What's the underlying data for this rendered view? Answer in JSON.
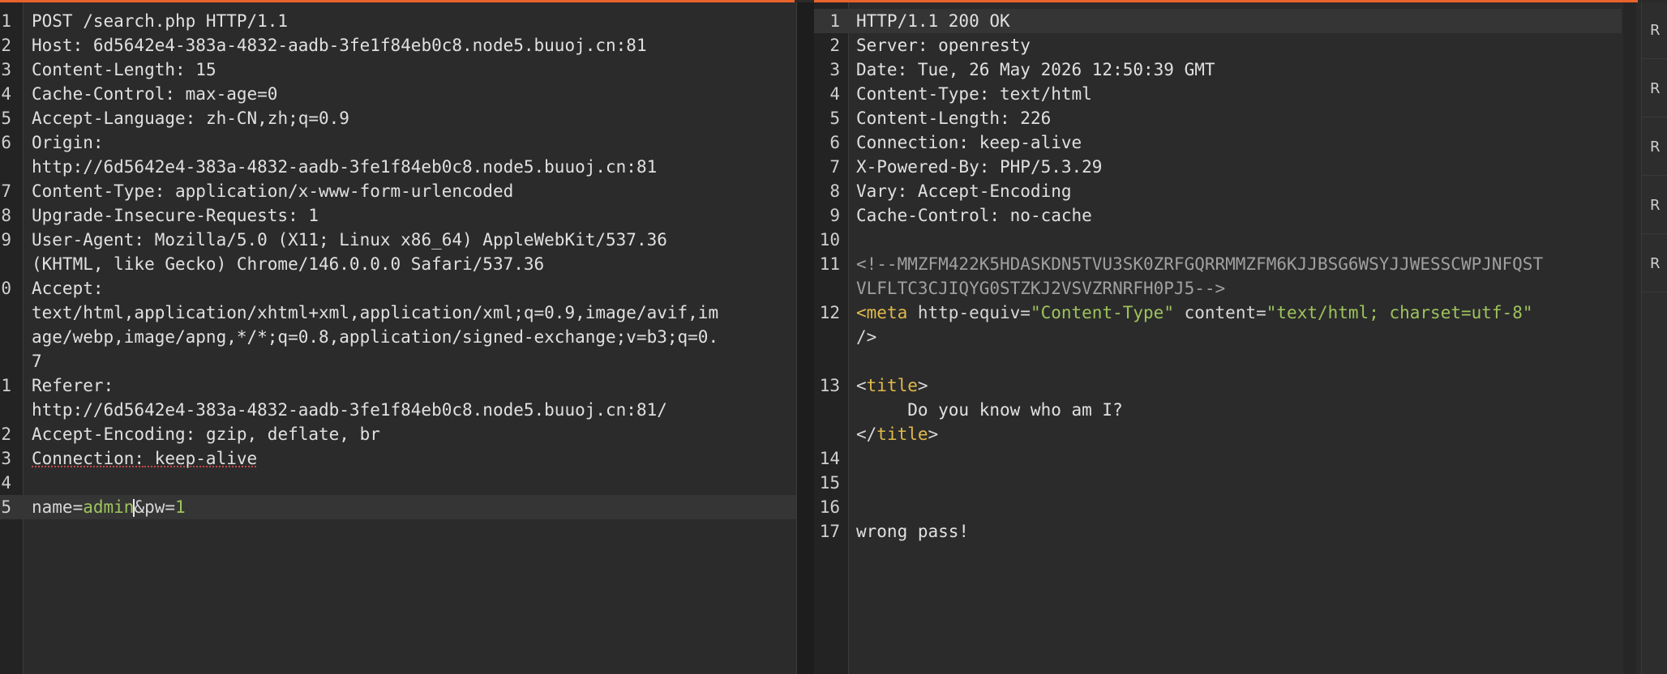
{
  "request": {
    "lines": [
      {
        "n": "1",
        "key": "",
        "val": "POST /search.php HTTP/1.1"
      },
      {
        "n": "2",
        "key": "Host:",
        "val": " 6d5642e4-383a-4832-aadb-3fe1f84eb0c8.node5.buuoj.cn:81"
      },
      {
        "n": "3",
        "key": "Content-Length:",
        "val": " 15"
      },
      {
        "n": "4",
        "key": "Cache-Control:",
        "val": " max-age=0"
      },
      {
        "n": "5",
        "key": "Accept-Language:",
        "val": " zh-CN,zh;q=0.9"
      },
      {
        "n": "6",
        "key": "Origin:",
        "val": ""
      },
      {
        "n": "",
        "key": "",
        "val": "http://6d5642e4-383a-4832-aadb-3fe1f84eb0c8.node5.buuoj.cn:81"
      },
      {
        "n": "7",
        "key": "Content-Type:",
        "val": " application/x-www-form-urlencoded"
      },
      {
        "n": "8",
        "key": "Upgrade-Insecure-Requests:",
        "val": " 1"
      },
      {
        "n": "9",
        "key": "User-Agent:",
        "val": " Mozilla/5.0 (X11; Linux x86_64) AppleWebKit/537.36"
      },
      {
        "n": "",
        "key": "",
        "val": "(KHTML, like Gecko) Chrome/146.0.0.0 Safari/537.36"
      },
      {
        "n": "0",
        "key": "Accept:",
        "val": ""
      },
      {
        "n": "",
        "key": "",
        "val": "text/html,application/xhtml+xml,application/xml;q=0.9,image/avif,im"
      },
      {
        "n": "",
        "key": "",
        "val": "age/webp,image/apng,*/*;q=0.8,application/signed-exchange;v=b3;q=0."
      },
      {
        "n": "",
        "key": "",
        "val": "7"
      },
      {
        "n": "1",
        "key": "Referer:",
        "val": ""
      },
      {
        "n": "",
        "key": "",
        "val": "http://6d5642e4-383a-4832-aadb-3fe1f84eb0c8.node5.buuoj.cn:81/"
      },
      {
        "n": "2",
        "key": "Accept-Encoding:",
        "val": " gzip, deflate, br"
      },
      {
        "n": "3",
        "key": "Connection:",
        "val": " keep-alive"
      },
      {
        "n": "4",
        "key": "",
        "val": ""
      }
    ],
    "body_line": {
      "n": "5",
      "name_key": "name=",
      "name_val_a": "admin",
      "name_val_b": "",
      "amp": "&",
      "pw_key": "pw=",
      "pw_val": "1"
    }
  },
  "response": {
    "lines": [
      {
        "n": "1",
        "key": "",
        "val": "HTTP/1.1 200 OK"
      },
      {
        "n": "2",
        "key": "Server:",
        "val": " openresty"
      },
      {
        "n": "3",
        "key": "Date:",
        "val": " Tue, 26 May 2026 12:50:39 GMT"
      },
      {
        "n": "4",
        "key": "Content-Type:",
        "val": " text/html"
      },
      {
        "n": "5",
        "key": "Content-Length:",
        "val": " 226"
      },
      {
        "n": "6",
        "key": "Connection:",
        "val": " keep-alive"
      },
      {
        "n": "7",
        "key": "X-Powered-By:",
        "val": " PHP/5.3.29"
      },
      {
        "n": "8",
        "key": "Vary:",
        "val": " Accept-Encoding"
      },
      {
        "n": "9",
        "key": "Cache-Control:",
        "val": " no-cache"
      },
      {
        "n": "10",
        "key": "",
        "val": ""
      }
    ],
    "comment_1": "<!--MMZFM422K5HDASKDN5TVU3SK0ZRFGQRRMMZFM6KJJBSG6WSYJJWESSCWPJNFQST",
    "comment_2": "VLFLTC3CJIQYG0STZKJ2VSVZRNRFH0PJ5-->",
    "meta_open": "<",
    "meta_tag": "meta",
    "meta_attr1": " http-equiv=",
    "meta_val1": "\"Content-Type\"",
    "meta_attr2": " content=",
    "meta_val2": "\"text/html; charset=utf-8\"",
    "meta_close": "/>",
    "title_open_lt": "<",
    "title_tag": "title",
    "title_gt": ">",
    "title_text": "     Do you know who am I?",
    "title_close_lt": "</",
    "body_text": "wrong pass!",
    "line_numbers": [
      "11",
      "12",
      "13",
      "14",
      "15",
      "16",
      "17"
    ]
  },
  "side_tabs": [
    "R",
    "R",
    "R",
    "R",
    "R"
  ]
}
